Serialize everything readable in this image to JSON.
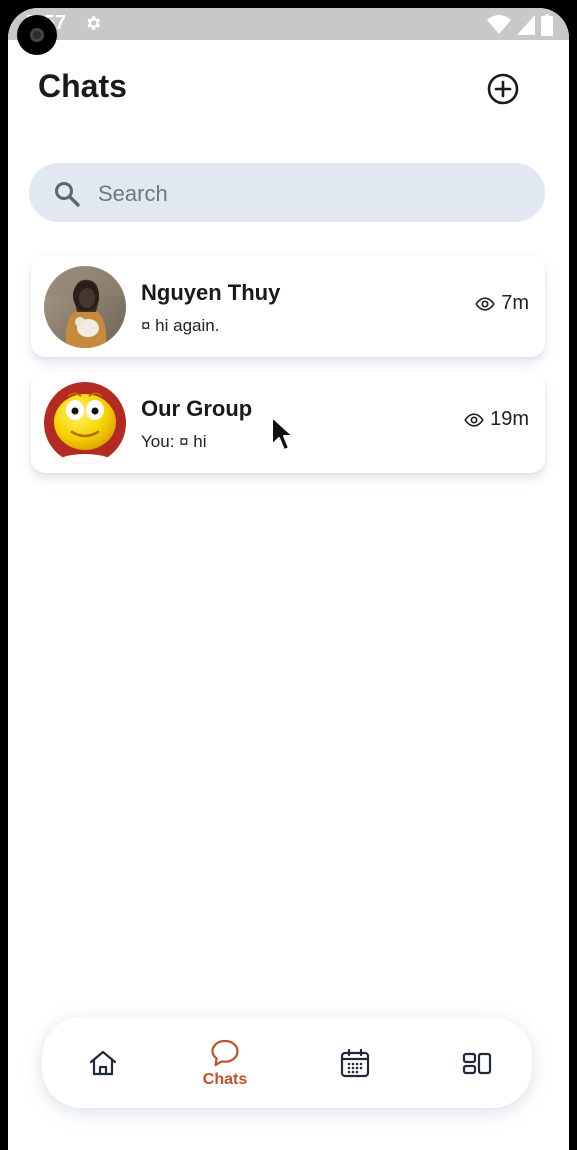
{
  "status_bar": {
    "time": "7:57",
    "settings_icon": "gear-icon",
    "icons": [
      "wifi-icon",
      "signal-icon",
      "battery-icon"
    ]
  },
  "header": {
    "title": "Chats",
    "add_icon": "plus-circle-icon"
  },
  "search": {
    "placeholder": "Search",
    "value": "",
    "icon": "search-icon"
  },
  "chats": [
    {
      "name": "Nguyen Thuy",
      "preview": "¤ hi again.",
      "time": "7m",
      "avatar": "photo-avatar"
    },
    {
      "name": "Our Group",
      "preview": "You: ¤ hi",
      "time": "19m",
      "avatar": "emoji-avatar"
    }
  ],
  "bottom_nav": {
    "items": [
      {
        "icon": "home-icon",
        "label": ""
      },
      {
        "icon": "chat-bubble-icon",
        "label": "Chats",
        "active": true
      },
      {
        "icon": "calendar-icon",
        "label": ""
      },
      {
        "icon": "dashboard-icon",
        "label": ""
      }
    ]
  },
  "colors": {
    "accent": "#c0502a",
    "search_bg": "#e1e8f2",
    "text": "#1a1a1a",
    "nav_icon": "#1e2a3a"
  }
}
